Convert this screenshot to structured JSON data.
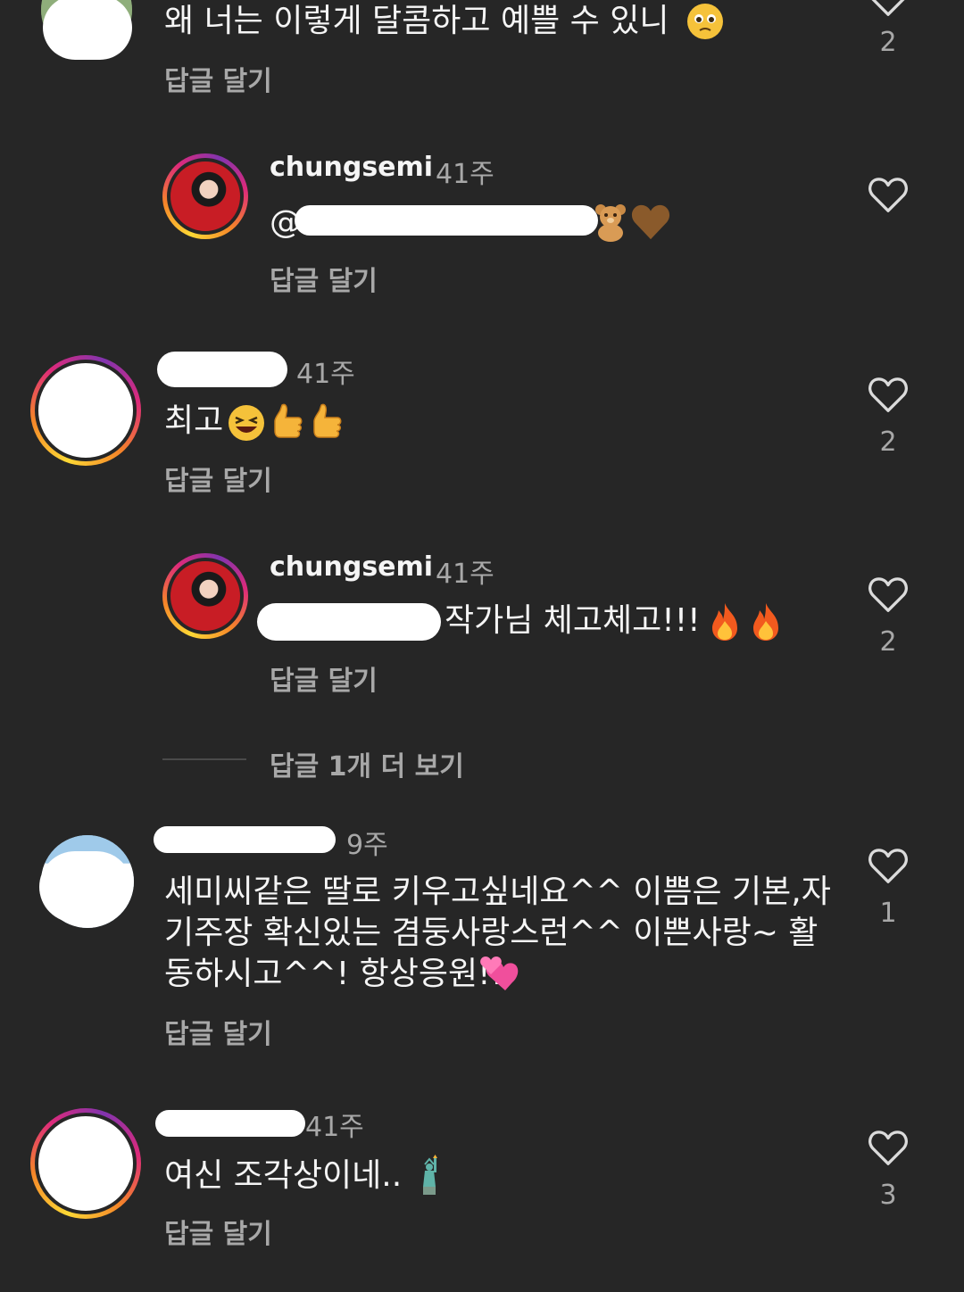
{
  "comments": [
    {
      "text": "왜 너는 이렇게 달콤하고 예쁠 수 있니",
      "reply": "답글 달기",
      "likes": "2"
    },
    {
      "username": "chungsemi",
      "time": "41주",
      "text": "@",
      "reply": "답글 달기"
    },
    {
      "time": "41주",
      "text": "최고",
      "reply": "답글 달기",
      "likes": "2"
    },
    {
      "username": "chungsemi",
      "time": "41주",
      "text": "작가님 체고체고!!!",
      "reply": "답글 달기",
      "likes": "2"
    },
    {
      "time": "9주",
      "text_lines": [
        "세미씨같은 딸로 키우고싶네요^^ 이쁨은 기본,자",
        "기주장 확신있는 겸둥사랑스런^^ 이쁜사랑~ 활",
        "동하시고^^! 항상응원!!"
      ],
      "reply": "답글 달기",
      "likes": "1"
    },
    {
      "time": "41주",
      "text": "여신 조각상이네..",
      "reply": "답글 달기",
      "likes": "3"
    }
  ],
  "view_more": "답글 1개 더 보기",
  "colors": {
    "background": "#262626",
    "secondary_text": "#a8a8a8",
    "primary_text": "#f5f5f5"
  }
}
